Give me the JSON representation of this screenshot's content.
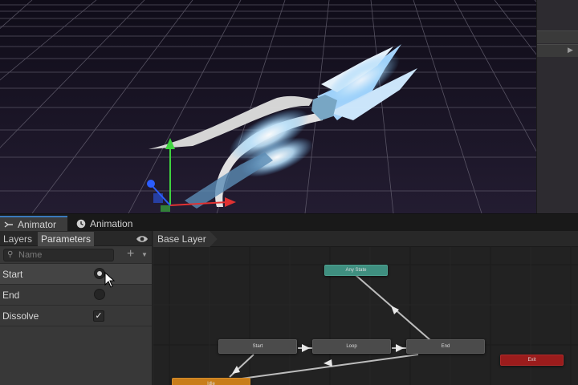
{
  "tabs": [
    {
      "label": "Animator",
      "icon": "animator-icon"
    },
    {
      "label": "Animation",
      "icon": "clock-icon"
    }
  ],
  "left_panel": {
    "subtabs": [
      "Layers",
      "Parameters"
    ],
    "active_subtab": "Parameters",
    "search_placeholder": "Name",
    "parameters": [
      {
        "name": "Start",
        "type": "trigger",
        "value": true,
        "selected": true
      },
      {
        "name": "End",
        "type": "trigger",
        "value": false,
        "selected": false
      },
      {
        "name": "Dissolve",
        "type": "bool",
        "value": true,
        "selected": false
      }
    ]
  },
  "graph": {
    "breadcrumb": "Base Layer",
    "states": {
      "any_state": "Any State",
      "start": "Start",
      "loop": "Loop",
      "end": "End",
      "exit": "Exit",
      "idle": "Idle"
    }
  },
  "colors": {
    "any_state": "#3f8f80",
    "exit": "#9b1c1c",
    "entry": "#c87d1a",
    "accent": "#3a79bb"
  }
}
